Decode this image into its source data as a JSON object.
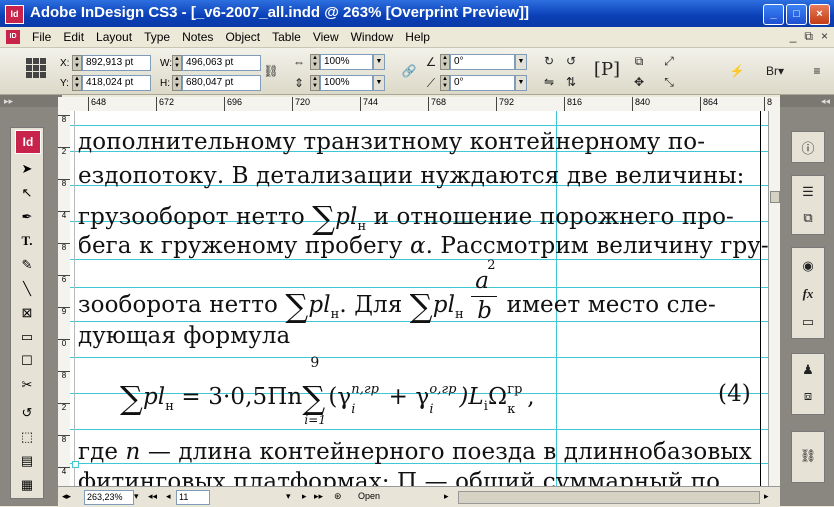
{
  "window": {
    "title": "Adobe InDesign CS3 - [_v6-2007_all.indd @ 263% [Overprint Preview]]",
    "app_icon": "Id",
    "buttons": [
      "_",
      "□",
      "×"
    ]
  },
  "menu": {
    "doc_icon": "ID",
    "items": [
      "File",
      "Edit",
      "Layout",
      "Type",
      "Notes",
      "Object",
      "Table",
      "View",
      "Window",
      "Help"
    ],
    "mdi_buttons": [
      "_",
      "⧉",
      "×"
    ]
  },
  "control_panel": {
    "x_label": "X:",
    "x_value": "892,913 pt",
    "y_label": "Y:",
    "y_value": "418,024 pt",
    "w_label": "W:",
    "w_value": "496,063 pt",
    "h_label": "H:",
    "h_value": "680,047 pt",
    "scale_x": "100%",
    "scale_y": "100%",
    "rotate": "0°",
    "shear": "0°",
    "style_label": "[P]"
  },
  "ruler": {
    "top_ticks": [
      "648",
      "672",
      "696",
      "720",
      "744",
      "768",
      "792",
      "816",
      "840",
      "864",
      "8"
    ],
    "left_ticks": [
      "8",
      "2",
      "8",
      "4",
      "8",
      "6",
      "9",
      "0",
      "8",
      "2",
      "8",
      "4"
    ]
  },
  "document": {
    "lines": [
      "дополнительному транзитному контейнерному по-",
      "ездопотоку. В детализации нуждаются две величины:",
      "грузооборот нетто",
      "и отношение порожнего про-",
      "бега к груженому пробегу",
      ". Рассмотрим величину гру-",
      "зооборота нетто",
      ". Для",
      "имеет место сле-",
      "дующая формула",
      "где",
      " — длина контейнерного поезда в длиннобазовых",
      "фитинговых платформах; П — общий суммарный по"
    ],
    "math": {
      "sum": "∑",
      "pl": "pl",
      "sub_n": "н",
      "alpha": "α",
      "frac_num": "a",
      "frac_num_sup": "2",
      "frac_den": "b",
      "formula_lhs": "pl",
      "formula_rhs": "= 3·0,5Пn",
      "sum_top": "9",
      "sum_bottom": "i=1",
      "gamma1": "γ",
      "gamma1_sup": "п,гр",
      "gamma1_sub": "i",
      "plus": " + ",
      "gamma2": "γ",
      "gamma2_sup": "о,гр",
      "gamma2_sub": "i",
      "tail": ")L",
      "tail_sub": "i",
      "omega": "Ω",
      "omega_sup": "гр",
      "omega_sub": "к",
      "comma": ",",
      "eq_number": "(4)",
      "open_paren": "(",
      "n_var": "n"
    }
  },
  "statusbar": {
    "zoom": "263,23%",
    "page": "11",
    "status": "Open"
  },
  "icons": {
    "tools": [
      "id-logo",
      "selection-icon",
      "direct-selection-icon",
      "pen-icon",
      "type-icon",
      "pencil-icon",
      "line-icon",
      "rectangle-frame-icon",
      "rectangle-icon",
      "button-icon",
      "scissors-icon",
      "rotate-icon",
      "free-transform-icon",
      "gradient-icon",
      "note-icon"
    ],
    "right_panel": [
      "info-icon",
      "stroke-icon",
      "pages-icon",
      "swatches-icon",
      "effects-icon",
      "gradient-panel-icon",
      "layers-icon",
      "links-icon"
    ]
  }
}
